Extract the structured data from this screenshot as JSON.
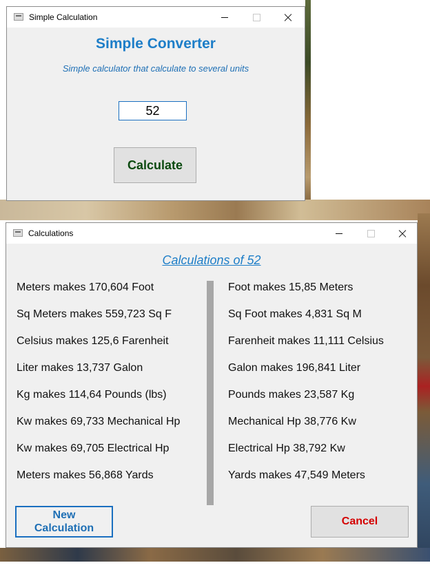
{
  "window1": {
    "title": "Simple Calculation",
    "heading": "Simple Converter",
    "subtitle": "Simple calculator that calculate to several units",
    "input_value": "52",
    "calculate_label": "Calculate"
  },
  "window2": {
    "title": "Calculations",
    "heading": "Calculations of 52",
    "left": [
      "Meters makes 170,604 Foot",
      "Sq Meters makes 559,723 Sq F",
      "Celsius makes 125,6 Farenheit",
      "Liter makes 13,737 Galon",
      "Kg makes 114,64 Pounds (lbs)",
      "Kw makes 69,733 Mechanical Hp",
      "Kw makes 69,705 Electrical Hp",
      "Meters makes 56,868 Yards"
    ],
    "right": [
      "Foot makes 15,85 Meters",
      "Sq Foot makes 4,831 Sq M",
      "Farenheit makes 11,111 Celsius",
      "Galon makes 196,841 Liter",
      "Pounds makes 23,587 Kg",
      "Mechanical Hp 38,776 Kw",
      "Electrical Hp 38,792 Kw",
      "Yards makes 47,549 Meters"
    ],
    "new_line1": "New",
    "new_line2": "Calculation",
    "cancel_label": "Cancel"
  }
}
